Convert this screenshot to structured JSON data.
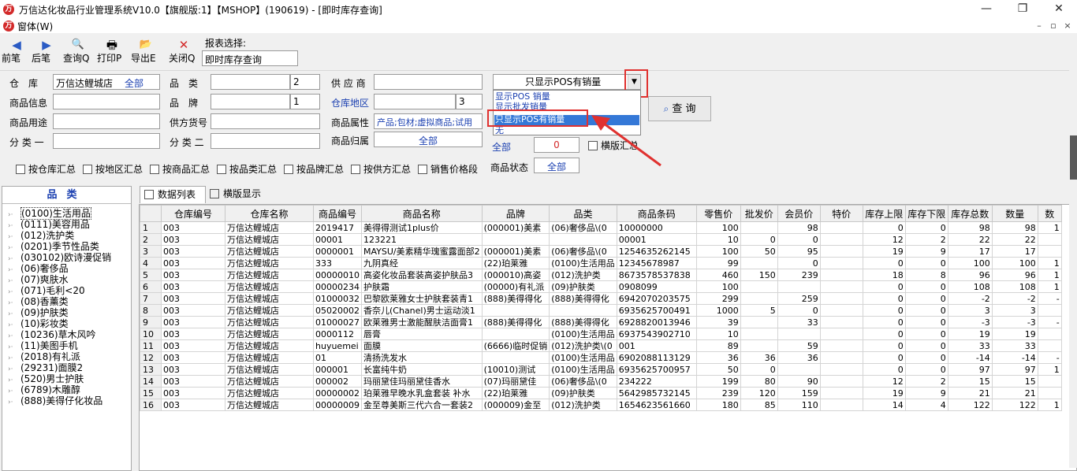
{
  "window": {
    "title": "万信达化妆品行业管理系统V10.0【旗舰版:1】【MSHOP】(190619) - [即时库存查询]",
    "minimize": "—",
    "restore": "❐",
    "close": "✕"
  },
  "menu": {
    "label": "窗体(W)",
    "mdi_min": "–",
    "mdi_restore": "▫",
    "mdi_close": "×"
  },
  "toolbar": {
    "buttons": [
      {
        "label": "前笔",
        "icon": "arrow-left-icon",
        "glyph": "◀"
      },
      {
        "label": "后笔",
        "icon": "arrow-right-icon",
        "glyph": "▶"
      },
      {
        "label": "查询Q",
        "icon": "query-icon",
        "glyph": "🔍"
      },
      {
        "label": "打印P",
        "icon": "printer-icon",
        "glyph": "🖶"
      },
      {
        "label": "导出E",
        "icon": "export-icon",
        "glyph": "📂"
      },
      {
        "label": "关闭Q",
        "icon": "close-icon",
        "glyph": "✕"
      }
    ],
    "report_label": "报表选择:",
    "report_value": "即时库存查询"
  },
  "filters": {
    "warehouse_label": "仓　库",
    "warehouse_value": "万信达鲤城店",
    "warehouse_all": "全部",
    "category_label": "品　类",
    "category_num": "2",
    "supplier_label": "供 应 商",
    "product_info_label": "商品信息",
    "brand_label": "品　牌",
    "brand_num": "1",
    "warehouse_area_label": "仓库地区",
    "warehouse_area_num": "3",
    "product_use_label": "商品用途",
    "supplier_code_label": "供方货号",
    "product_attr_label": "商品属性",
    "product_attr_value": "产品;包材;虚拟商品;试用",
    "class1_label": "分 类 一",
    "class2_label": "分 类 二",
    "product_owner_label": "商品归属",
    "product_owner_value": "全部",
    "all_label": "全部",
    "zero_value": "0",
    "horizontal_summary": "横版汇总",
    "product_status_label": "商品状态",
    "product_status_value": "全部",
    "combo_value": "只显示POS有销量",
    "dropdown_options": [
      "显示POS 销量",
      "显示批发销量",
      "只显示POS有销量",
      "无"
    ],
    "query_button": "查 询",
    "summary_checks": [
      "按仓库汇总",
      "按地区汇总",
      "按商品汇总",
      "按品类汇总",
      "按品牌汇总",
      "按供方汇总",
      "销售价格段"
    ]
  },
  "left": {
    "header": "品类",
    "items": [
      "(0100)生活用品",
      "(0111)美容用品",
      "(012)洗护类",
      "(0201)季节性品类",
      "(030102)欧诗漫促销",
      "(06)奢侈品",
      "(07)爽肤水",
      "(071)毛利<20",
      "(08)香薰类",
      "(09)护肤类",
      "(10)彩妆类",
      "(10236)草木风吟",
      "(11)美图手机",
      "(2018)有礼派",
      "(29231)面膜2",
      "(520)男士护肤",
      "(6789)木雕醇",
      "(888)美得仔化妆品"
    ]
  },
  "tabs": [
    {
      "label": "数据列表"
    },
    {
      "label": "横版显示"
    }
  ],
  "grid": {
    "columns": [
      "",
      "仓库编号",
      "仓库名称",
      "商品编号",
      "商品名称",
      "品牌",
      "品类",
      "商品条码",
      "零售价",
      "批发价",
      "会员价",
      "特价",
      "库存上限",
      "库存下限",
      "库存总数",
      "数量",
      "数"
    ],
    "rows": [
      [
        "1",
        "003",
        "万信达鲤城店",
        "2019417",
        "美得得测试1plus价",
        "(000001)美素",
        "(06)奢侈品\\(0",
        "10000000",
        "100",
        "",
        "98",
        "",
        "0",
        "0",
        "98",
        "98",
        "1"
      ],
      [
        "2",
        "003",
        "万信达鲤城店",
        "00001",
        "123221",
        "",
        "",
        "00001",
        "10",
        "0",
        "0",
        "",
        "12",
        "2",
        "22",
        "22",
        ""
      ],
      [
        "3",
        "003",
        "万信达鲤城店",
        "0000001",
        "MAYSU/美素精华瑰蜜露面部2",
        "(000001)美素",
        "(06)奢侈品\\(0",
        "1254635262145",
        "100",
        "50",
        "95",
        "",
        "19",
        "9",
        "17",
        "17",
        ""
      ],
      [
        "4",
        "003",
        "万信达鲤城店",
        "333",
        "九阴真经",
        "(22)珀莱雅",
        "(0100)生活用品",
        "12345678987",
        "99",
        "",
        "0",
        "",
        "0",
        "0",
        "100",
        "100",
        "1"
      ],
      [
        "5",
        "003",
        "万信达鲤城店",
        "00000010",
        "高姿化妆品套装高姿护肤品3",
        "(000010)高姿",
        "(012)洗护类",
        "8673578537838",
        "460",
        "150",
        "239",
        "",
        "18",
        "8",
        "96",
        "96",
        "1"
      ],
      [
        "6",
        "003",
        "万信达鲤城店",
        "00000234",
        "护肤霜",
        "(00000)有礼派",
        "(09)护肤类",
        "0908099",
        "100",
        "",
        "",
        "",
        "0",
        "0",
        "108",
        "108",
        "1"
      ],
      [
        "7",
        "003",
        "万信达鲤城店",
        "01000032",
        "巴黎欧莱雅女士护肤套装青1",
        "(888)美得得化",
        "(888)美得得化",
        "6942070203575",
        "299",
        "",
        "259",
        "",
        "0",
        "0",
        "-2",
        "-2",
        "-"
      ],
      [
        "8",
        "003",
        "万信达鲤城店",
        "05020002",
        "香奈儿(Chanel)男士运动淡1",
        "",
        "",
        "6935625700491",
        "1000",
        "5",
        "0",
        "",
        "0",
        "0",
        "3",
        "3",
        ""
      ],
      [
        "9",
        "003",
        "万信达鲤城店",
        "01000027",
        "欧莱雅男士激能醒肤洁面膏1",
        "(888)美得得化",
        "(888)美得得化",
        "6928820013946",
        "39",
        "",
        "33",
        "",
        "0",
        "0",
        "-3",
        "-3",
        "-"
      ],
      [
        "10",
        "003",
        "万信达鲤城店",
        "0000112",
        "唇膏",
        "",
        "(0100)生活用品",
        "6937543902710",
        "10",
        "",
        "",
        "",
        "0",
        "0",
        "19",
        "19",
        ""
      ],
      [
        "11",
        "003",
        "万信达鲤城店",
        "huyuemei",
        "面膜",
        "(6666)临时促销",
        "(012)洗护类\\(0",
        "001",
        "89",
        "",
        "59",
        "",
        "0",
        "0",
        "33",
        "33",
        ""
      ],
      [
        "12",
        "003",
        "万信达鲤城店",
        "01",
        "清扬洗发水",
        "",
        "(0100)生活用品",
        "6902088113129",
        "36",
        "36",
        "36",
        "",
        "0",
        "0",
        "-14",
        "-14",
        "-"
      ],
      [
        "13",
        "003",
        "万信达鲤城店",
        "000001",
        "长富纯牛奶",
        "(10010)测试",
        "(0100)生活用品",
        "6935625700957",
        "50",
        "0",
        "",
        "",
        "0",
        "0",
        "97",
        "97",
        "1"
      ],
      [
        "14",
        "003",
        "万信达鲤城店",
        "000002",
        "玛丽黛佳玛丽黛佳香水",
        "(07)玛丽黛佳",
        "(06)奢侈品\\(0",
        "234222",
        "199",
        "80",
        "90",
        "",
        "12",
        "2",
        "15",
        "15",
        ""
      ],
      [
        "15",
        "003",
        "万信达鲤城店",
        "00000002",
        "珀莱雅早晚水乳盒套装 补水",
        "(22)珀莱雅",
        "(09)护肤类",
        "5642985732145",
        "239",
        "120",
        "159",
        "",
        "19",
        "9",
        "21",
        "21",
        ""
      ],
      [
        "16",
        "003",
        "万信达鲤城店",
        "00000009",
        "金至尊美斯三代六合一套装2",
        "(000009)金至",
        "(012)洗护类",
        "1654623561660",
        "180",
        "85",
        "110",
        "",
        "14",
        "4",
        "122",
        "122",
        "1"
      ]
    ]
  },
  "colors": {
    "accent_blue": "#1a3fb0",
    "highlight_red": "#e0312f",
    "selection": "#3478d7"
  }
}
